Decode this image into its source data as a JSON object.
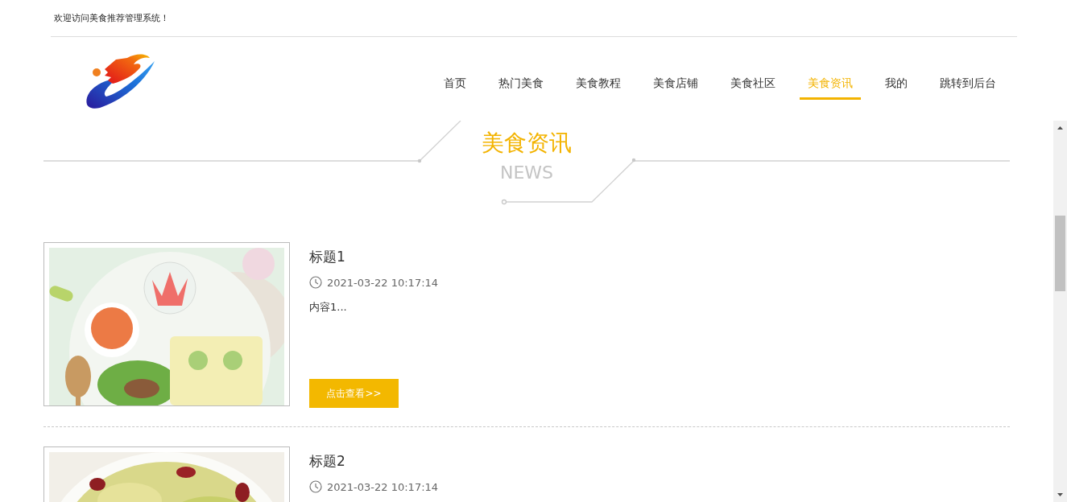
{
  "top_bar": {
    "welcome": "欢迎访问美食推荐管理系统！"
  },
  "nav": [
    {
      "label": "首页",
      "selected": false
    },
    {
      "label": "热门美食",
      "selected": false
    },
    {
      "label": "美食教程",
      "selected": false
    },
    {
      "label": "美食店铺",
      "selected": false
    },
    {
      "label": "美食社区",
      "selected": false
    },
    {
      "label": "美食资讯",
      "selected": true
    },
    {
      "label": "我的",
      "selected": false
    },
    {
      "label": "跳转到后台",
      "selected": false
    }
  ],
  "section": {
    "title": "美食资讯",
    "subtitle": "NEWS"
  },
  "news": [
    {
      "kind": "picture",
      "title": "标题1",
      "time": "2021-03-22 10:17:14",
      "content": "内容1...",
      "button": "点击查看>>"
    },
    {
      "kind": "picture",
      "title": "标题2",
      "time": "2021-03-22 10:17:14"
    }
  ]
}
